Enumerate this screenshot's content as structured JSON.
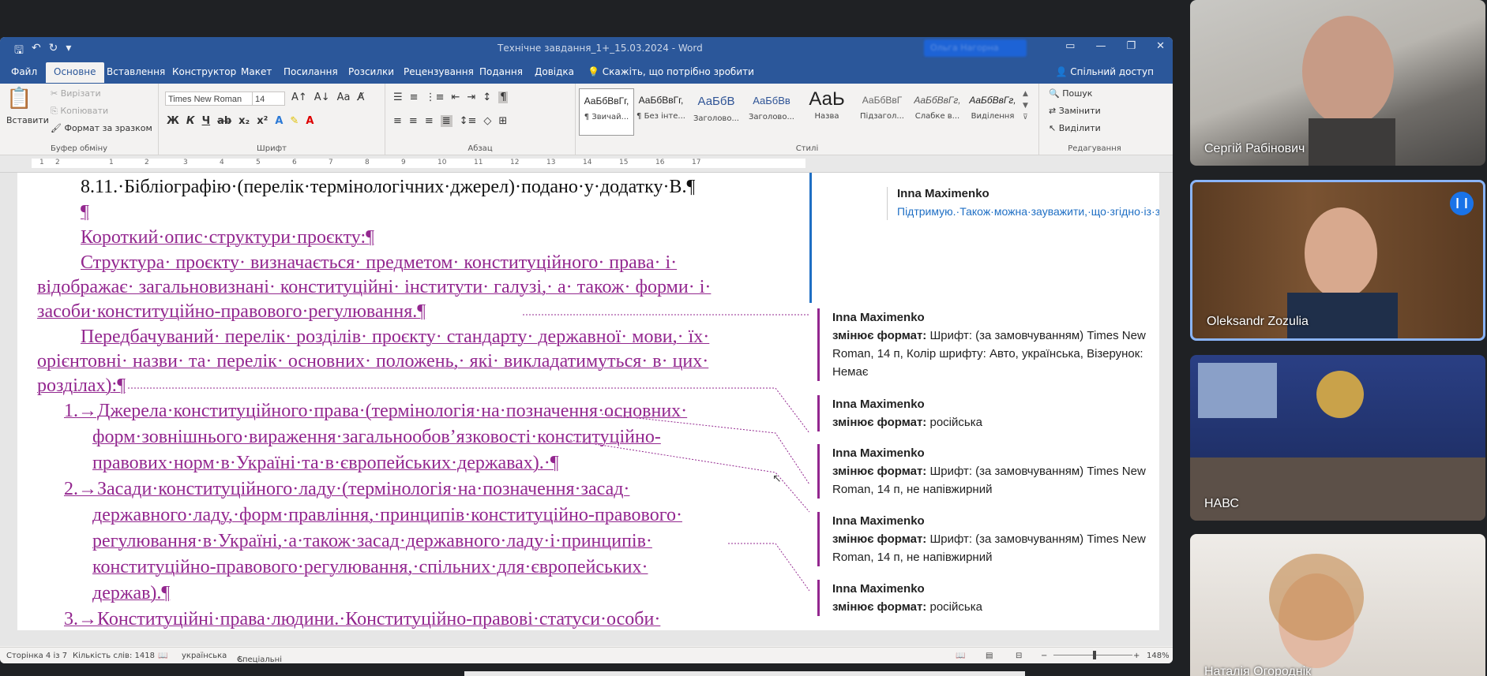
{
  "window": {
    "title": "Технічне завдання_1+_15.03.2024 - Word",
    "user_name_blurred": "Ольга Нагорна"
  },
  "tabs": [
    "Файл",
    "Основне",
    "Вставлення",
    "Конструктор",
    "Макет",
    "Посилання",
    "Розсилки",
    "Рецензування",
    "Подання",
    "Довідка"
  ],
  "tell_me": "Скажіть, що потрібно зробити",
  "share": "Спільний доступ",
  "ribbon": {
    "clipboard": {
      "paste": "Вставити",
      "cut": "Вирізати",
      "copy": "Копіювати",
      "format_painter": "Формат за зразком",
      "label": "Буфер обміну"
    },
    "font": {
      "name": "Times New Roman",
      "size": "14",
      "label": "Шрифт"
    },
    "paragraph": {
      "label": "Абзац"
    },
    "styles": {
      "label": "Стилі",
      "items": [
        {
          "sample": "АаБбВвГг,",
          "name": "¶ Звичай..."
        },
        {
          "sample": "АаБбВвГг,",
          "name": "¶ Без інте..."
        },
        {
          "sample": "АаБбВ",
          "name": "Заголово..."
        },
        {
          "sample": "АаБбВв",
          "name": "Заголово..."
        },
        {
          "sample": "АаЬ",
          "name": "Назва"
        },
        {
          "sample": "АаБбВвГ",
          "name": "Підзагол..."
        },
        {
          "sample": "АаБбВвГг,",
          "name": "Слабке в..."
        },
        {
          "sample": "АаБбВвГг,",
          "name": "Виділення"
        }
      ]
    },
    "editing": {
      "find": "Пошук",
      "replace": "Замінити",
      "select": "Виділити",
      "label": "Редагування"
    }
  },
  "ruler_ticks": [
    "1",
    "2",
    "1",
    "2",
    "3",
    "4",
    "5",
    "6",
    "7",
    "8",
    "9",
    "10",
    "11",
    "12",
    "13",
    "14",
    "15",
    "16",
    "17"
  ],
  "document": {
    "lines": [
      "8.11.·Бібліографію·(перелік·термінологічних·джерел)·подано·у·додатку·В.¶",
      "¶",
      "Короткий·опис·структури·проєкту:¶",
      "Структура· проєкту· визначається· предметом· конституційного· права· і·",
      "відображає· загальновизнані· конституційні· інститути· галузі,· а· також· форми· і·",
      "засоби·конституційно-правового·регулювання.¶",
      "Передбачуваний· перелік· розділів· проєкту· стандарту· державної· мови,· їх·",
      "орієнтовні· назви· та· перелік· основних· положень,· які· викладатимуться· в· цих·",
      "розділах):¶",
      "1.→Джерела·конституційного·права·(термінологія·на·позначення·основних·",
      "форм·зовнішнього·вираження·загальнообов’язковості·конституційно-",
      "правових·норм·в·Україні·та·в·європейських·державах).·¶",
      "2.→Засади·конституційного·ладу·(термінологія·на·позначення·засад·",
      "державного·ладу,·форм·правління,·принципів·конституційно-правового·",
      "регулювання·в·Україні,·а·також·засад·державного·ладу·і·принципів·",
      "конституційно-правового·регулювання,·спільних·для·європейських·",
      "держав).¶",
      "3.→Конституційні·права·людини.·Конституційно-правові·статуси·особи·"
    ]
  },
  "comments": {
    "first": {
      "author": "Inna Maximenko",
      "text": "Підтримую.·Також·можна·зауважити,·що·згідно·із·затвердженими·вимогами·в·ТЗ·подавати·як·завершену·дію·«наведено»·не·вимагається.¶"
    },
    "changes": [
      {
        "author": "Inna Maximenko",
        "label": "змінює формат:",
        "text": "Шрифт: (за замовчуванням) Times New Roman, 14 п, Колір шрифту: Авто, українська, Візерунок: Немає"
      },
      {
        "author": "Inna Maximenko",
        "label": "змінює формат:",
        "text": "російська"
      },
      {
        "author": "Inna Maximenko",
        "label": "змінює формат:",
        "text": "Шрифт: (за замовчуванням) Times New Roman, 14 п, не напівжирний"
      },
      {
        "author": "Inna Maximenko",
        "label": "змінює формат:",
        "text": "Шрифт: (за замовчуванням) Times New Roman, 14 п, не напівжирний"
      },
      {
        "author": "Inna Maximenko",
        "label": "змінює формат:",
        "text": "російська"
      }
    ]
  },
  "status": {
    "page": "Сторінка 4 із 7",
    "words": "Кількість слів: 1418",
    "lang": "українська",
    "access": "Спеціальні можливості: щось не так",
    "zoom": "148%"
  },
  "participants": [
    "Сергій Рабінович",
    "Oleksandr Zozulia",
    "НАВС",
    "Наталія Огороднік"
  ],
  "colors": {
    "word_blue": "#2b579a",
    "insertion": "#93278f",
    "comment_text": "#1f6fc4",
    "active_speaker": "#1a73e8"
  }
}
